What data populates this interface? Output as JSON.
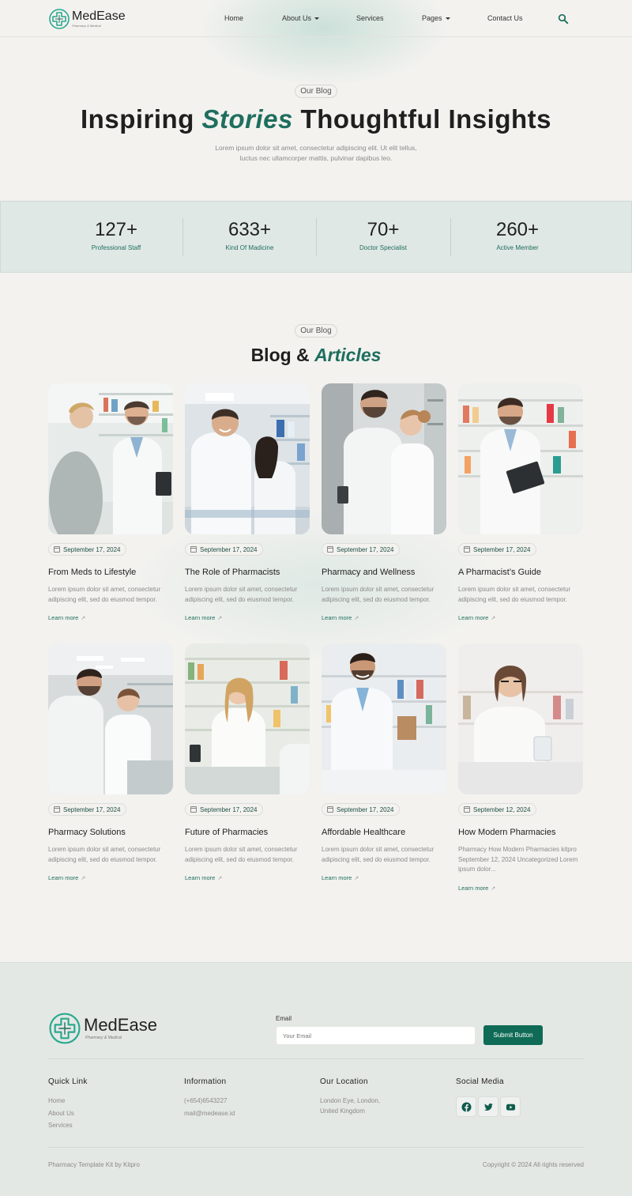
{
  "brand": {
    "name": "MedEase",
    "tagline": "Pharmacy & Medical"
  },
  "nav": {
    "items": [
      "Home",
      "About Us",
      "Services",
      "Pages",
      "Contact Us"
    ]
  },
  "hero": {
    "pill": "Our Blog",
    "title_start": "Inspiring ",
    "title_accent": "Stories",
    "title_end": " Thoughtful Insights",
    "subtitle": "Lorem ipsum dolor sit amet, consectetur adipiscing elit. Ut elit tellus, luctus nec ullamcorper mattis, pulvinar dapibus leo."
  },
  "stats": [
    {
      "value": "127+",
      "label": "Professional Staff"
    },
    {
      "value": "633+",
      "label": "Kind Of Madicine"
    },
    {
      "value": "70+",
      "label": "Doctor Specialist"
    },
    {
      "value": "260+",
      "label": "Active Member"
    }
  ],
  "blog": {
    "pill": "Our Blog",
    "title_start": "Blog & ",
    "title_accent": "Articles",
    "learn_more": "Learn more",
    "cards": [
      {
        "date": "September 17, 2024",
        "title": "From Meds to Lifestyle",
        "desc": "Lorem ipsum dolor sit amet, consectetur adipiscing elit, sed do eiusmod tempor."
      },
      {
        "date": "September 17, 2024",
        "title": "The Role of Pharmacists",
        "desc": "Lorem ipsum dolor sit amet, consectetur adipiscing elit, sed do eiusmod tempor."
      },
      {
        "date": "September 17, 2024",
        "title": "Pharmacy and Wellness",
        "desc": "Lorem ipsum dolor sit amet, consectetur adipiscing elit, sed do eiusmod tempor."
      },
      {
        "date": "September 17, 2024",
        "title": "A Pharmacist’s Guide",
        "desc": "Lorem ipsum dolor sit amet, consectetur adipiscing elit, sed do eiusmod tempor."
      },
      {
        "date": "September 17, 2024",
        "title": "Pharmacy Solutions",
        "desc": "Lorem ipsum dolor sit amet, consectetur adipiscing elit, sed do eiusmod tempor."
      },
      {
        "date": "September 17, 2024",
        "title": "Future of Pharmacies",
        "desc": "Lorem ipsum dolor sit amet, consectetur adipiscing elit, sed do eiusmod tempor."
      },
      {
        "date": "September 17, 2024",
        "title": "Affordable Healthcare",
        "desc": "Lorem ipsum dolor sit amet, consectetur adipiscing elit, sed do eiusmod tempor."
      },
      {
        "date": "September 12, 2024",
        "title": "How Modern Pharmacies",
        "desc": "Pharmacy How Modern Pharmacies kitpro September 12, 2024 Uncategorized Lorem ipsum dolor..."
      }
    ]
  },
  "footer": {
    "email_label": "Email",
    "email_placeholder": "Your Email",
    "submit": "Submit Button",
    "quick_link": {
      "title": "Quick Link",
      "items": [
        "Home",
        "About Us",
        "Services"
      ]
    },
    "information": {
      "title": "Information",
      "items": [
        "(+654)6543227",
        "mail@medease.id"
      ]
    },
    "location": {
      "title": "Our Location",
      "items": [
        "London Eye, London,",
        "United Kingdom"
      ]
    },
    "social": {
      "title": "Social Media",
      "icons": [
        "facebook-icon",
        "twitter-icon",
        "youtube-icon"
      ]
    },
    "credit": "Pharmacy Template Kit by Kitpro",
    "copyright": "Copyright © 2024 All rights reserved"
  },
  "colors": {
    "accent": "#1e6e5e",
    "button": "#0f6b56",
    "background": "#f3f2ef",
    "stats_band": "#e0e8e5",
    "footer": "#e4e8e5"
  }
}
